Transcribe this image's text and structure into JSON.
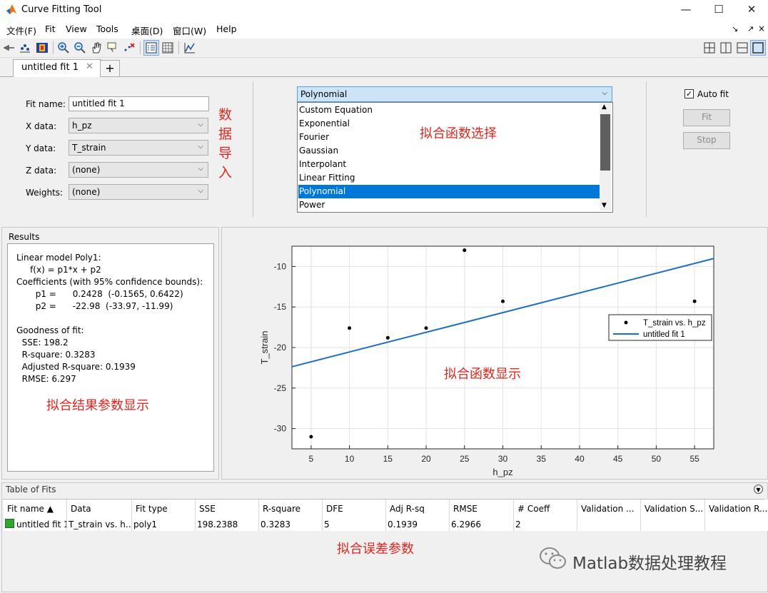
{
  "window": {
    "title": "Curve Fitting Tool",
    "minimize": "—",
    "maximize": "☐",
    "close": "✕"
  },
  "menu": [
    "文件(F)",
    "Fit",
    "View",
    "Tools",
    "桌面(D)",
    "窗口(W)",
    "Help"
  ],
  "tabs": {
    "active_label": "untitled fit 1",
    "close": "✕",
    "add": "+"
  },
  "fit_settings": {
    "fit_name_label": "Fit name:",
    "fit_name_value": "untitled fit 1",
    "x_label": "X data:",
    "x_value": "h_pz",
    "y_label": "Y data:",
    "y_value": "T_strain",
    "z_label": "Z data:",
    "z_value": "(none)",
    "w_label": "Weights:",
    "w_value": "(none)"
  },
  "fit_type": {
    "selected": "Polynomial",
    "options": [
      "Custom Equation",
      "Exponential",
      "Fourier",
      "Gaussian",
      "Interpolant",
      "Linear Fitting",
      "Polynomial",
      "Power"
    ]
  },
  "controls": {
    "auto_fit_label": "Auto fit",
    "auto_fit_checked": true,
    "fit_button": "Fit",
    "stop_button": "Stop"
  },
  "annotations": {
    "data_import": [
      "数",
      "据",
      "导",
      "入"
    ],
    "fit_func_select": "拟合函数选择",
    "fit_func_display": "拟合函数显示",
    "fit_result_display": "拟合结果参数显示",
    "fit_error_params": "拟合误差参数"
  },
  "results": {
    "title": "Results",
    "lines": [
      "Linear model Poly1:",
      "     f(x) = p1*x + p2",
      "Coefficients (with 95% confidence bounds):",
      "       p1 =      0.2428  (-0.1565, 0.6422)",
      "       p2 =      -22.98  (-33.97, -11.99)",
      "",
      "Goodness of fit:",
      "  SSE: 198.2",
      "  R-square: 0.3283",
      "  Adjusted R-square: 0.1939",
      "  RMSE: 6.297"
    ]
  },
  "chart_data": {
    "type": "scatter",
    "xlabel": "h_pz",
    "ylabel": "T_strain",
    "xlim": [
      2.5,
      57.5
    ],
    "ylim": [
      -32.5,
      -7.5
    ],
    "xticks": [
      5,
      10,
      15,
      20,
      25,
      30,
      35,
      40,
      45,
      50,
      55
    ],
    "yticks": [
      -10,
      -15,
      -20,
      -25,
      -30
    ],
    "grid": true,
    "legend_position": "right",
    "series": [
      {
        "name": "T_strain vs. h_pz",
        "kind": "points",
        "color": "#000000",
        "x": [
          5,
          10,
          15,
          20,
          25,
          30,
          55
        ],
        "y": [
          -31.0,
          -17.6,
          -18.8,
          -17.6,
          -8.0,
          -14.3,
          -14.3
        ]
      },
      {
        "name": "untitled fit 1",
        "kind": "line",
        "color": "#1f6fc0",
        "x": [
          2.5,
          57.5
        ],
        "y": [
          -22.37,
          -9.02
        ]
      }
    ]
  },
  "table": {
    "title": "Table of Fits",
    "columns": [
      "Fit name",
      "Data",
      "Fit type",
      "SSE",
      "R-square",
      "DFE",
      "Adj R-sq",
      "RMSE",
      "# Coeff",
      "Validation ...",
      "Validation S...",
      "Validation R..."
    ],
    "sort_indicator": "▲",
    "rows": [
      [
        "untitled fit 1",
        "T_strain vs. h...",
        "poly1",
        "198.2388",
        "0.3283",
        "5",
        "0.1939",
        "6.2966",
        "2",
        "",
        "",
        ""
      ]
    ]
  },
  "watermark": "Matlab数据处理教程"
}
